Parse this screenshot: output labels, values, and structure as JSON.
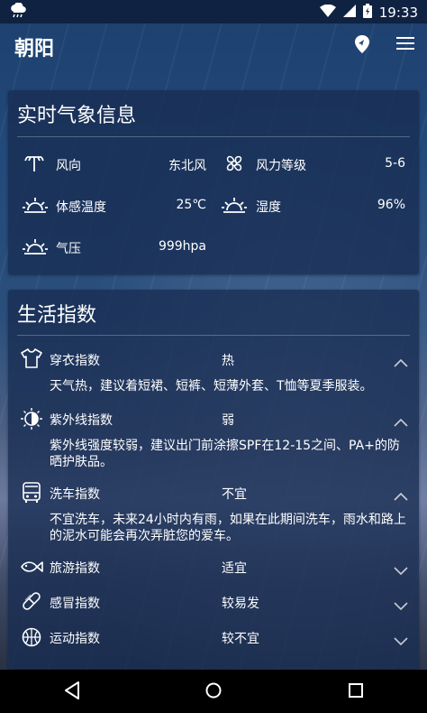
{
  "status_bar": {
    "time": "19:33"
  },
  "app_bar": {
    "city": "朝阳"
  },
  "realtime": {
    "title": "实时气象信息",
    "items": [
      {
        "label": "风向",
        "value": "东北风"
      },
      {
        "label": "风力等级",
        "value": "5-6"
      },
      {
        "label": "体感温度",
        "value": "25℃"
      },
      {
        "label": "湿度",
        "value": "96%"
      },
      {
        "label": "气压",
        "value": "999hpa"
      }
    ]
  },
  "life_index": {
    "title": "生活指数",
    "items": [
      {
        "label": "穿衣指数",
        "value": "热",
        "desc": "天气热，建议着短裙、短裤、短薄外套、T恤等夏季服装。",
        "expanded": true
      },
      {
        "label": "紫外线指数",
        "value": "弱",
        "desc": "紫外线强度较弱，建议出门前涂擦SPF在12-15之间、PA+的防晒护肤品。",
        "expanded": true
      },
      {
        "label": "洗车指数",
        "value": "不宜",
        "desc": "不宜洗车，未来24小时内有雨，如果在此期间洗车，雨水和路上的泥水可能会再次弄脏您的爱车。",
        "expanded": true
      },
      {
        "label": "旅游指数",
        "value": "适宜",
        "expanded": false
      },
      {
        "label": "感冒指数",
        "value": "较易发",
        "expanded": false
      },
      {
        "label": "运动指数",
        "value": "较不宜",
        "expanded": false
      }
    ]
  }
}
